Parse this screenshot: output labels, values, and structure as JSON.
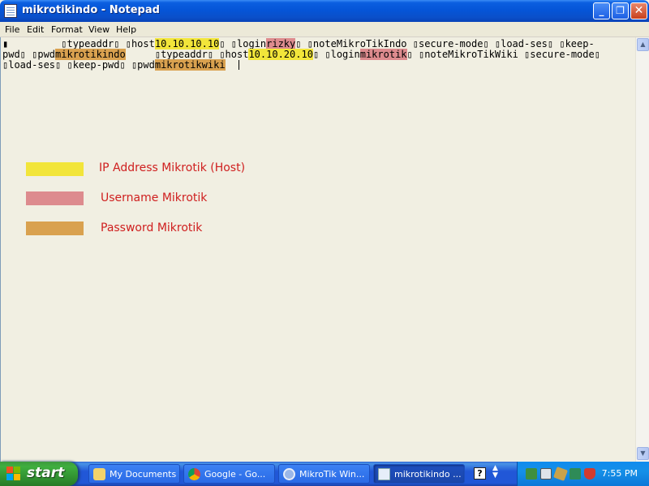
{
  "window": {
    "title": "mikrotikindo - Notepad",
    "buttons": {
      "minimize": "_",
      "maximize": "❐",
      "close": "✕"
    }
  },
  "menu": [
    "File",
    "Edit",
    "Format",
    "View",
    "Help"
  ],
  "editor": {
    "line1": {
      "a": "▮         ▯typeaddr▯ ▯host",
      "host1": "10.10.10.10",
      "b": "▯ ▯login",
      "user1": "rizky",
      "c": "▯ ▯noteMikroTikIndo ▯secure-mode▯ ▯load-ses▯ ▯keep-"
    },
    "line2": {
      "a": "pwd▯ ▯pwd",
      "pass1": "mikrotikindo",
      "b": "     ▯typeaddr▯ ▯host",
      "host2": "10.10.20.10",
      "c": "▯ ▯login",
      "user2": "mikrotik",
      "d": "▯ ▯noteMikroTikWiki ▯secure-mode▯"
    },
    "line3": {
      "a": "▯load-ses▯ ▯keep-pwd▯ ▯pwd",
      "pass2": "mikrotikwiki",
      "b": "  "
    }
  },
  "legend": [
    {
      "label": "IP Address Mikrotik (Host)",
      "color": "#f2e53a"
    },
    {
      "label": "Username Mikrotik",
      "color": "#dd8b8e"
    },
    {
      "label": "Password Mikrotik",
      "color": "#d9a14f"
    }
  ],
  "taskbar": {
    "start_label": "start",
    "tasks": [
      {
        "label": "My Documents",
        "icon": "folder-icon"
      },
      {
        "label": "Google - Go...",
        "icon": "chrome-icon"
      },
      {
        "label": "MikroTik Win...",
        "icon": "winbox-icon"
      },
      {
        "label": "mikrotikindo ...",
        "icon": "notepad-icon"
      }
    ],
    "clock": "7:55 PM"
  },
  "colors": {
    "titlebar": "#0555d8",
    "legend_text": "#cf1f1f",
    "taskbar": "#2157d7",
    "start": "#3fae3f"
  }
}
